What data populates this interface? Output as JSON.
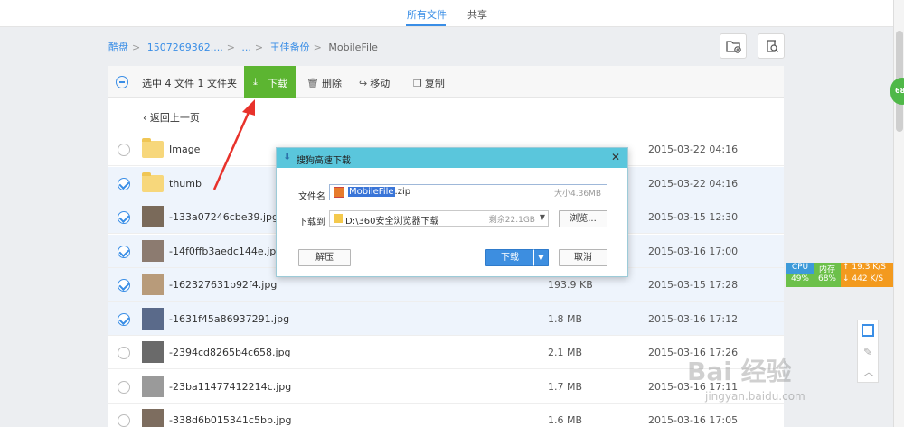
{
  "tabs": [
    {
      "label": "所有文件",
      "active": true
    },
    {
      "label": "共享",
      "active": false
    }
  ],
  "breadcrumb": [
    "酷盘",
    "1507269362....",
    "...",
    "王佳备份",
    "MobileFile"
  ],
  "actionbar": {
    "selection": "选中 4 文件 1 文件夹",
    "download": "下载",
    "delete": "删除",
    "move": "移动",
    "copy": "复制"
  },
  "back_label": "返回上一页",
  "files": [
    {
      "name": "Image",
      "size": "",
      "date": "2015-03-22 04:16",
      "type": "folder",
      "selected": false
    },
    {
      "name": "thumb",
      "size": "",
      "date": "2015-03-22 04:16",
      "type": "folder",
      "selected": true
    },
    {
      "name": "-133a07246cbe39.jpg",
      "size": "",
      "date": "2015-03-15 12:30",
      "type": "image",
      "selected": true
    },
    {
      "name": "-14f0ffb3aedc144e.jpg",
      "size": "",
      "date": "2015-03-16 17:00",
      "type": "image",
      "selected": true
    },
    {
      "name": "-162327631b92f4.jpg",
      "size": "193.9 KB",
      "date": "2015-03-15 17:28",
      "type": "image",
      "selected": true
    },
    {
      "name": "-1631f45a86937291.jpg",
      "size": "1.8 MB",
      "date": "2015-03-16 17:12",
      "type": "image",
      "selected": true
    },
    {
      "name": "-2394cd8265b4c658.jpg",
      "size": "2.1 MB",
      "date": "2015-03-16 17:26",
      "type": "image",
      "selected": false
    },
    {
      "name": "-23ba11477412214c.jpg",
      "size": "1.7 MB",
      "date": "2015-03-16 17:11",
      "type": "image",
      "selected": false
    },
    {
      "name": "-338d6b015341c5bb.jpg",
      "size": "1.6 MB",
      "date": "2015-03-16 17:05",
      "type": "image",
      "selected": false
    }
  ],
  "dialog": {
    "title": "搜狗高速下载",
    "filename_label": "文件名",
    "filename_highlight": "MobileFile",
    "filename_ext": ".zip",
    "size_text": "大小4.36MB",
    "dest_label": "下载到",
    "dest_path": "D:\\360安全浏览器下载",
    "free_space": "剩余22.1GB",
    "browse": "浏览...",
    "unzip": "解压",
    "download": "下载",
    "cancel": "取消"
  },
  "side_stats": {
    "cpu_label": "CPU",
    "cpu_value": "49%",
    "mem_label": "内存",
    "mem_value": "68%",
    "up_speed": "19.3 K/S",
    "down_speed": "442 K/S"
  },
  "badge": "68",
  "watermark": "Bai 经验",
  "watermark_url": "jingyan.baidu.com",
  "colors": {
    "accent": "#3a8ee6",
    "download_green": "#5cb531",
    "dialog_title": "#5ac6dc",
    "arrow": "#e8322b"
  }
}
